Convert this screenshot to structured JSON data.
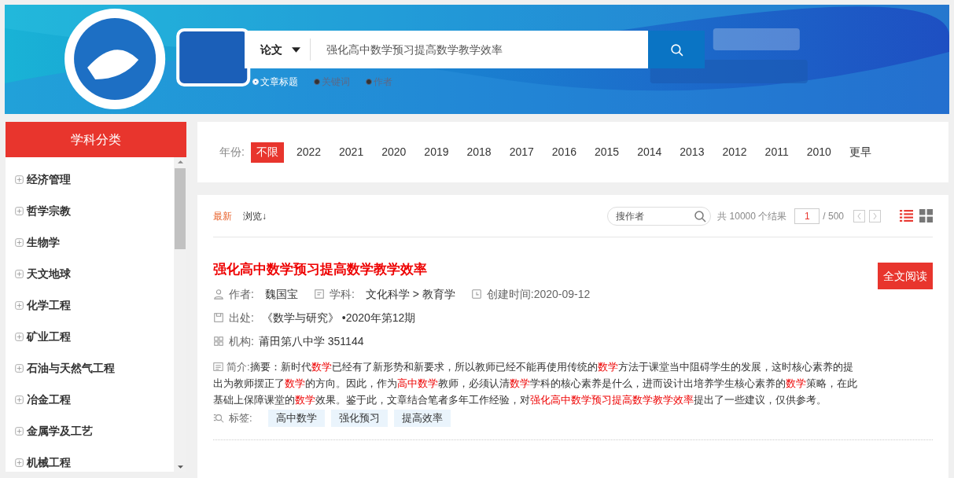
{
  "search": {
    "type_label": "论文",
    "query": "强化高中数学预习提高数学教学效率",
    "options": [
      {
        "label": "文章标题",
        "selected": true
      },
      {
        "label": "关键词",
        "selected": false
      },
      {
        "label": "作者",
        "selected": false
      }
    ]
  },
  "sidebar": {
    "title": "学科分类",
    "items": [
      {
        "label": "经济管理",
        "expanded": false
      },
      {
        "label": "哲学宗教",
        "expanded": false
      },
      {
        "label": "生物学",
        "expanded": false
      },
      {
        "label": "天文地球",
        "expanded": false
      },
      {
        "label": "化学工程",
        "expanded": false
      },
      {
        "label": "矿业工程",
        "expanded": false
      },
      {
        "label": "石油与天然气工程",
        "expanded": false
      },
      {
        "label": "冶金工程",
        "expanded": false
      },
      {
        "label": "金属学及工艺",
        "expanded": false
      },
      {
        "label": "机械工程",
        "expanded": false
      }
    ]
  },
  "year_filter": {
    "label": "年份:",
    "years": [
      {
        "label": "不限",
        "selected": true
      },
      {
        "label": "2022",
        "selected": false
      },
      {
        "label": "2021",
        "selected": false
      },
      {
        "label": "2020",
        "selected": false
      },
      {
        "label": "2019",
        "selected": false
      },
      {
        "label": "2018",
        "selected": false
      },
      {
        "label": "2017",
        "selected": false
      },
      {
        "label": "2016",
        "selected": false
      },
      {
        "label": "2015",
        "selected": false
      },
      {
        "label": "2014",
        "selected": false
      },
      {
        "label": "2013",
        "selected": false
      },
      {
        "label": "2012",
        "selected": false
      },
      {
        "label": "2011",
        "selected": false
      },
      {
        "label": "2010",
        "selected": false
      },
      {
        "label": "更早",
        "selected": false
      }
    ]
  },
  "toolbar": {
    "sorts": [
      {
        "label": "最新",
        "selected": true
      },
      {
        "label": "浏览↓",
        "selected": false
      }
    ],
    "author_placeholder": "搜作者",
    "total": "共 10000 个结果",
    "page": "1",
    "pages": "/ 500",
    "views": [
      {
        "kind": "list",
        "selected": true
      },
      {
        "kind": "grid",
        "selected": false
      }
    ]
  },
  "results": [
    {
      "title": "强化高中数学预习提高数学教学效率",
      "read_button": "全文阅读",
      "author_label": "作者:",
      "author": "魏国宝",
      "subject_label": "学科:",
      "subject": "文化科学 > 教育学",
      "created_label": "创建时间:",
      "created": "2020-09-12",
      "source_label": "出处:",
      "source": "《数学与研究》 •2020年第12期",
      "org_label": "机构:",
      "org": "莆田第八中学 351144",
      "abstract_label": "简介:",
      "abstract": [
        {
          "text": "摘要：新时代",
          "highlight": false
        },
        {
          "text": "数学",
          "highlight": true
        },
        {
          "text": "已经有了新形势和新要求，所以教师已经不能再使用传统的",
          "highlight": false
        },
        {
          "text": "数学",
          "highlight": true
        },
        {
          "text": "方法于课堂当中阻碍学生的发展，这时核心素养的提出为教师摆正了",
          "highlight": false
        },
        {
          "text": "数学",
          "highlight": true
        },
        {
          "text": "的方向。因此，作为",
          "highlight": false
        },
        {
          "text": "高中数学",
          "highlight": true
        },
        {
          "text": "教师，必须认清",
          "highlight": false
        },
        {
          "text": "数学",
          "highlight": true
        },
        {
          "text": "学科的核心素养是什么，进而设计出培养学生核心素养的",
          "highlight": false
        },
        {
          "text": "数学",
          "highlight": true
        },
        {
          "text": "策略，在此基础上保障课堂的",
          "highlight": false
        },
        {
          "text": "数学",
          "highlight": true
        },
        {
          "text": "效果。鉴于此，文章结合笔者多年工作经验，对",
          "highlight": false
        },
        {
          "text": "强化高中数学预习提高数学教学效率",
          "highlight": true
        },
        {
          "text": "提出了一些建议，仅供参考。",
          "highlight": false
        }
      ],
      "tags_label": "标签:",
      "tags": [
        "高中数学",
        "强化预习",
        "提高效率"
      ]
    }
  ]
}
